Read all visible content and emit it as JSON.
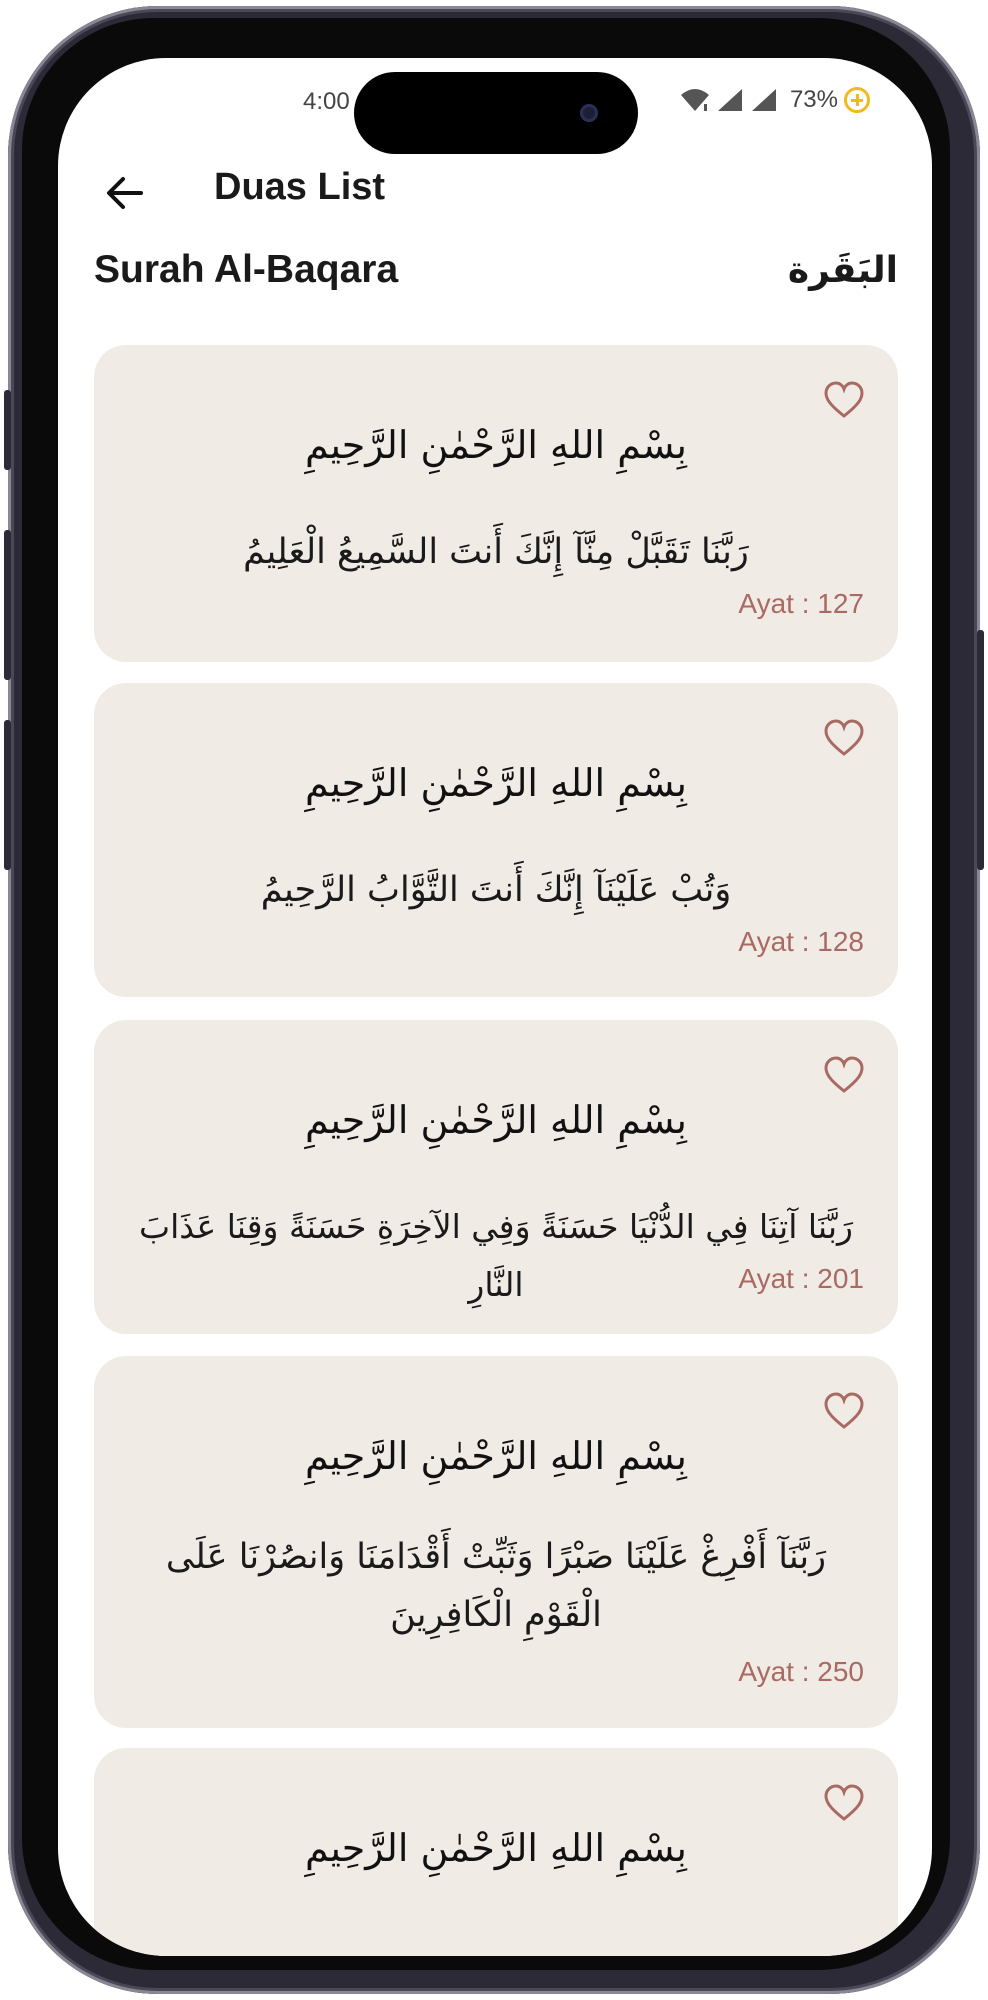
{
  "status_bar": {
    "time": "4:00",
    "battery_percent": "73%",
    "icons": [
      "wifi-icon",
      "signal-icon",
      "signal-icon",
      "battery-saver-icon"
    ]
  },
  "app_bar": {
    "back_icon": "arrow-left-icon",
    "title": "Duas List"
  },
  "surah": {
    "name_en": "Surah Al-Baqara",
    "name_ar": "البَقَرة"
  },
  "colors": {
    "card_background": "#f1ebe6",
    "accent": "#a86a62",
    "text": "#1a1a1a"
  },
  "duas": [
    {
      "bismillah": "بِسْمِ اللهِ الرَّحْمٰنِ الرَّحِيمِ",
      "text": "رَبَّنَا تَقَبَّلْ مِنَّآ إِنَّكَ أَنتَ السَّمِيعُ الْعَلِيمُ",
      "ayat": "Ayat : 127",
      "favorite_icon": "heart-outline-icon"
    },
    {
      "bismillah": "بِسْمِ اللهِ الرَّحْمٰنِ الرَّحِيمِ",
      "text": "وَتُبْ عَلَيْنَآ إِنَّكَ أَنتَ التَّوَّابُ الرَّحِيمُ",
      "ayat": "Ayat : 128",
      "favorite_icon": "heart-outline-icon"
    },
    {
      "bismillah": "بِسْمِ اللهِ الرَّحْمٰنِ الرَّحِيمِ",
      "text": "رَبَّنَا آتِنَا فِي الدُّنْيَا حَسَنَةً وَفِي الآخِرَةِ حَسَنَةً وَقِنَا عَذَابَ النَّارِ",
      "ayat": "Ayat : 201",
      "favorite_icon": "heart-outline-icon"
    },
    {
      "bismillah": "بِسْمِ اللهِ الرَّحْمٰنِ الرَّحِيمِ",
      "text": "رَبَّنَآ أَفْرِغْ عَلَيْنَا صَبْرًا وَثَبِّتْ أَقْدَامَنَا وَانصُرْنَا عَلَى الْقَوْمِ الْكَافِرِينَ",
      "ayat": "Ayat : 250",
      "favorite_icon": "heart-outline-icon"
    },
    {
      "bismillah": "بِسْمِ اللهِ الرَّحْمٰنِ الرَّحِيمِ",
      "text": "",
      "ayat": "",
      "favorite_icon": "heart-outline-icon"
    }
  ]
}
